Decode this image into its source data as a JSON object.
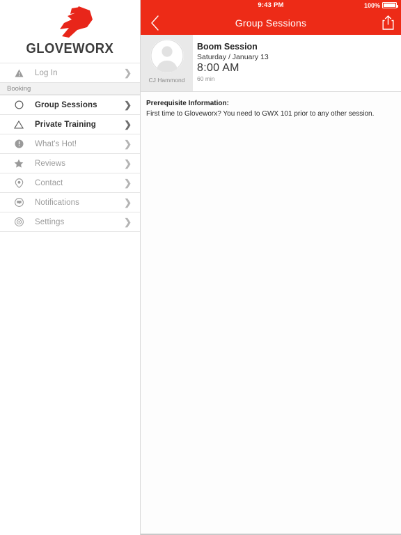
{
  "statusbar": {
    "time": "9:43 PM",
    "battery_percent": "100%",
    "battery_icon": "battery-full-icon"
  },
  "navbar": {
    "title": "Group Sessions",
    "back_icon": "chevron-left-icon",
    "share_icon": "share-icon",
    "accent_color": "#ED2B17"
  },
  "sidebar": {
    "logo": {
      "mark_icon": "gloveworx-bolt-logo",
      "wordmark": "GLOVEWORX",
      "mark_color": "#E8261A",
      "word_color": "#3C3C3C"
    },
    "login": {
      "label": "Log In",
      "icon": "warning-triangle-icon",
      "chevron": "chevron-right-icon"
    },
    "section_label": "Booking",
    "items": [
      {
        "label": "Group Sessions",
        "icon": "circle-outline-icon",
        "active": true,
        "chevron": "chevron-right-icon"
      },
      {
        "label": "Private Training",
        "icon": "triangle-outline-icon",
        "active": true,
        "chevron": "chevron-right-icon"
      },
      {
        "label": "What's Hot!",
        "icon": "exclamation-circle-icon",
        "active": false,
        "chevron": "chevron-right-icon"
      },
      {
        "label": "Reviews",
        "icon": "star-icon",
        "active": false,
        "chevron": "chevron-right-icon"
      },
      {
        "label": "Contact",
        "icon": "location-pin-icon",
        "active": false,
        "chevron": "chevron-right-icon"
      },
      {
        "label": "Notifications",
        "icon": "chat-bubble-icon",
        "active": false,
        "chevron": "chevron-right-icon"
      },
      {
        "label": "Settings",
        "icon": "gear-icon",
        "active": false,
        "chevron": "chevron-right-icon"
      }
    ]
  },
  "session": {
    "trainer_name": "CJ Hammond",
    "avatar_icon": "person-avatar-icon",
    "title": "Boom Session",
    "date": "Saturday / January 13",
    "time": "8:00 AM",
    "duration": "60 min"
  },
  "content": {
    "prereq_title": "Prerequisite Information:",
    "prereq_body": "First time to Gloveworx? You need to GWX 101 prior to any other session."
  }
}
